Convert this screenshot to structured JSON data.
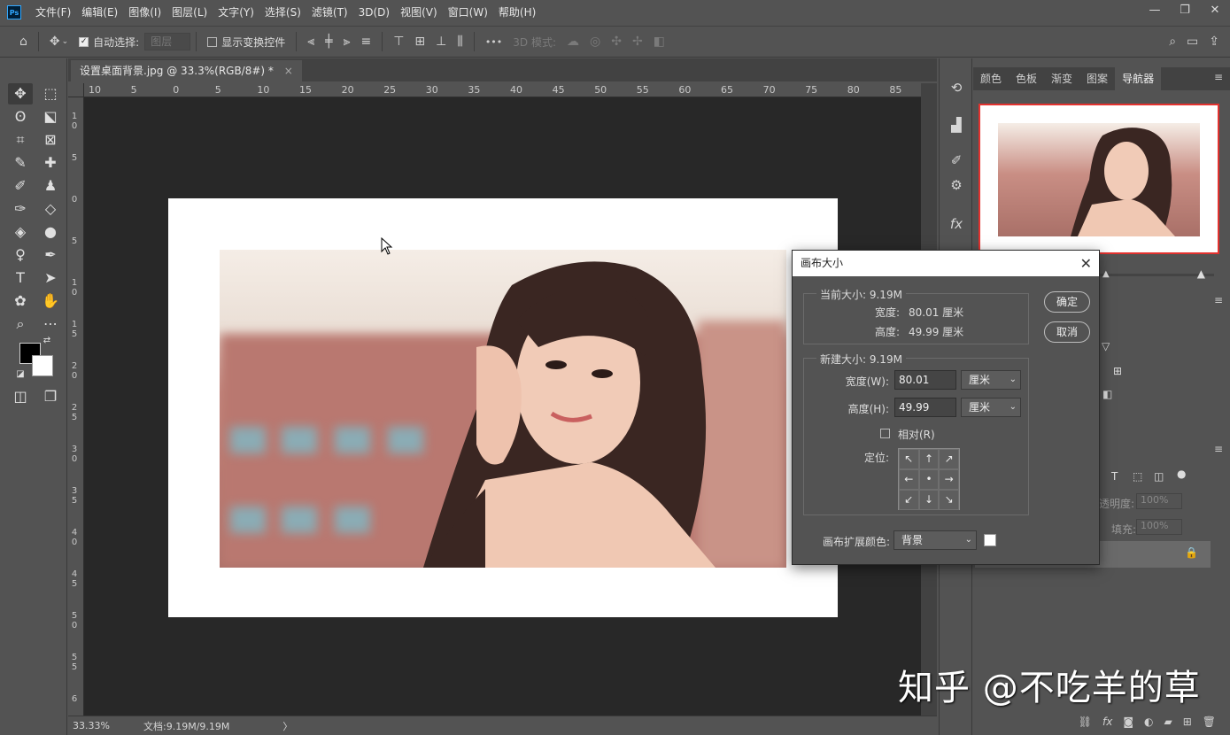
{
  "app": {
    "logo": "Ps"
  },
  "menu": [
    "文件(F)",
    "编辑(E)",
    "图像(I)",
    "图层(L)",
    "文字(Y)",
    "选择(S)",
    "滤镜(T)",
    "3D(D)",
    "视图(V)",
    "窗口(W)",
    "帮助(H)"
  ],
  "window_controls": {
    "minimize": "—",
    "restore": "❐",
    "close": "✕"
  },
  "options": {
    "auto_select_label": "自动选择:",
    "auto_select_value": "图层",
    "show_transform_label": "显示变换控件",
    "mode_3d_label": "3D 模式:",
    "more_label": "•••"
  },
  "document": {
    "tab_title": "设置桌面背景.jpg @ 33.3%(RGB/8#) *",
    "tab_close": "×"
  },
  "ruler_top": [
    "10",
    "5",
    "0",
    "5",
    "10",
    "15",
    "20",
    "25",
    "30",
    "35",
    "40",
    "45",
    "50",
    "55",
    "60",
    "65",
    "70",
    "75",
    "80",
    "85"
  ],
  "ruler_left": [
    "1\n0",
    "5",
    "0",
    "5",
    "1\n0",
    "1\n5",
    "2\n0",
    "2\n5",
    "3\n0",
    "3\n5",
    "4\n0",
    "4\n5",
    "5\n0",
    "5\n5",
    "6"
  ],
  "status": {
    "zoom": "33.33%",
    "doc_info": "文档:9.19M/9.19M",
    "arrow": "〉"
  },
  "panels": {
    "tabs": [
      "颜色",
      "色板",
      "渐变",
      "图案",
      "导航器"
    ],
    "active_tab": "导航器",
    "layers": {
      "opacity_label": "透明度:",
      "opacity_value": "100%",
      "fill_label": "填充:",
      "fill_value": "100%"
    }
  },
  "dialog": {
    "title": "画布大小",
    "close": "✕",
    "current_size_label": "当前大小: 9.19M",
    "current_width_label": "宽度:",
    "current_width_value": "80.01 厘米",
    "current_height_label": "高度:",
    "current_height_value": "49.99 厘米",
    "new_size_label": "新建大小: 9.19M",
    "new_width_label": "宽度(W):",
    "new_width_value": "80.01",
    "new_width_unit": "厘米",
    "new_height_label": "高度(H):",
    "new_height_value": "49.99",
    "new_height_unit": "厘米",
    "relative_label": "相对(R)",
    "anchor_label": "定位:",
    "anchor_arrows": [
      "↖",
      "↑",
      "↗",
      "←",
      "•",
      "→",
      "↙",
      "↓",
      "↘"
    ],
    "ext_color_label": "画布扩展颜色:",
    "ext_color_value": "背景",
    "ok": "确定",
    "cancel": "取消"
  },
  "watermark": "知乎 @不吃羊的草",
  "colors": {
    "accent_red": "#e3322f",
    "ui_bg": "#535353",
    "canvas_bg": "#282828"
  }
}
